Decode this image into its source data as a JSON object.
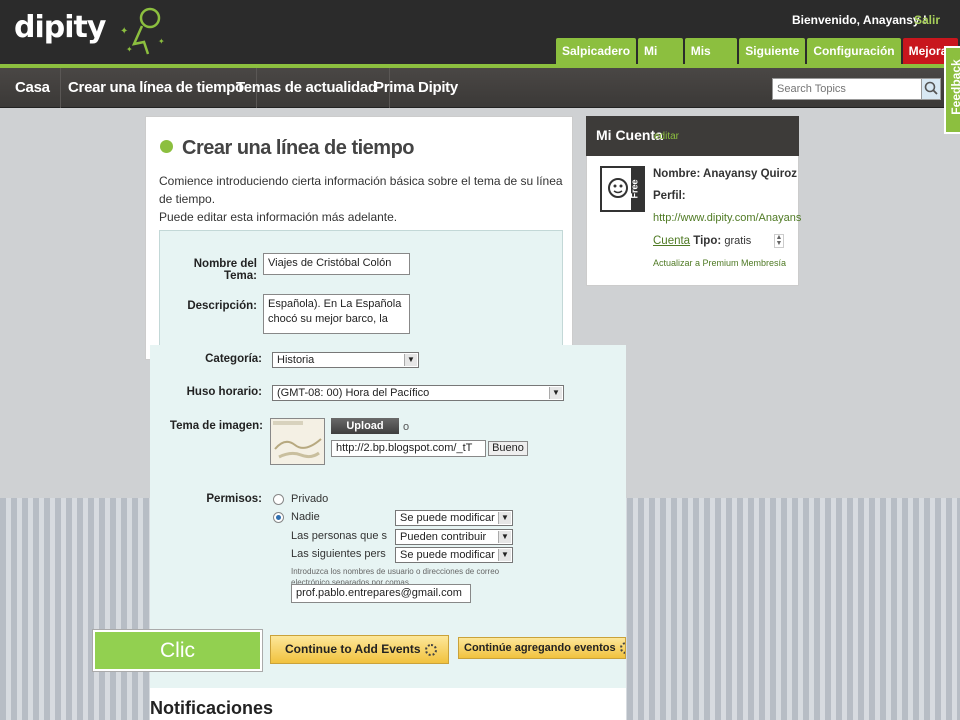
{
  "header": {
    "logo": "dipity",
    "welcome": "Bienvenido, Anayansy !",
    "logout": "Salir",
    "tabs": [
      {
        "label": "Salpicadero"
      },
      {
        "label": "Mi Perfil"
      },
      {
        "label": "Mis temas"
      },
      {
        "label": "Siguiente"
      },
      {
        "label": "Configuración"
      },
      {
        "label": "Mejorar"
      }
    ]
  },
  "nav": {
    "items": [
      {
        "label": "Casa"
      },
      {
        "label": "Crear una línea de tiempo"
      },
      {
        "label": "Temas de actualidad"
      },
      {
        "label": "Prima Dipity"
      }
    ],
    "search_placeholder": "Search Topics"
  },
  "feedback": "Feedback",
  "create": {
    "title": "Crear una línea de tiempo",
    "desc_line1": "Comience introduciendo cierta información básica sobre el tema de su línea de tiempo.",
    "desc_line2": "Puede editar esta información más adelante.",
    "topic_label": "Nombre del Tema:",
    "topic_value": "Viajes de Cristóbal Colón",
    "desc_label": "Descripción:",
    "desc_value_line1": "Española). En La Española",
    "desc_value_line2": "chocó su mejor barco, la",
    "category_label": "Categoría:",
    "category_value": "Historia",
    "timezone_label": "Huso horario:",
    "timezone_value": "(GMT-08: 00) Hora del Pacífico",
    "image_label": "Tema de imagen:",
    "upload_label": "Upload",
    "or": "o",
    "image_url": "http://2.bp.blogspot.com/_tT",
    "good_label": "Bueno",
    "permissions_label": "Permisos:",
    "private_label": "Privado",
    "none_label": "Nadie",
    "none_select": "Se puede modificar",
    "people_label": "Las personas que s",
    "people_select": "Pueden contribuir",
    "following_label": "Las siguientes pers",
    "following_select": "Se puede modificar",
    "hint_line1": "Introduzca los nombres de usuario o direcciones de correo",
    "hint_line2": "electrónico separados por comas.",
    "email_value": "prof.pablo.entrepares@gmail.com",
    "continue_en": "Continue to Add Events",
    "continue_es": "Continúe agregando eventos",
    "notifications": "Notificaciones"
  },
  "account": {
    "title": "Mi Cuenta",
    "edit": "editar",
    "name": "Nombre: Anayansy Quiroz",
    "profile_label": "Perfil:",
    "profile_url": "http://www.dipity.com/Anayans",
    "account_link": "Cuenta",
    "type_label": "Tipo:",
    "type_value": "gratis",
    "upgrade": "Actualizar a Premium Membresía",
    "badge": "Free"
  },
  "callout": "Clic",
  "colors": {
    "green": "#8cbf3f",
    "red": "#c8161d",
    "callout": "#92d050"
  }
}
